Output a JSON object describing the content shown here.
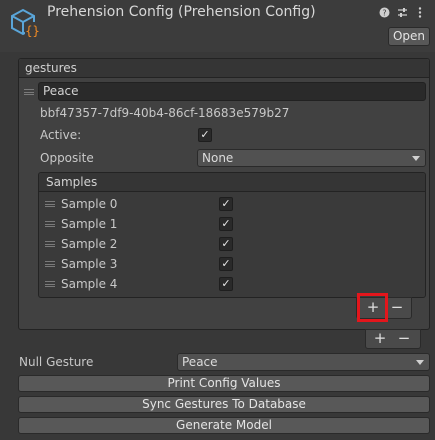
{
  "header": {
    "title": "Prehension Config (Prehension Config)",
    "open_label": "Open",
    "icons": [
      "help-icon",
      "settings-sliders-icon",
      "more-menu-icon"
    ]
  },
  "gestures": {
    "label": "gestures",
    "items": [
      {
        "name": "Peace",
        "guid": "bbf47357-7df9-40b4-86cf-18683e579b27",
        "active_label": "Active:",
        "active": true,
        "opposite_label": "Opposite",
        "opposite_value": "None",
        "samples": {
          "label": "Samples",
          "items": [
            {
              "label": "Sample 0",
              "checked": true
            },
            {
              "label": "Sample 1",
              "checked": true
            },
            {
              "label": "Sample 2",
              "checked": true
            },
            {
              "label": "Sample 3",
              "checked": true
            },
            {
              "label": "Sample 4",
              "checked": true
            }
          ]
        }
      }
    ]
  },
  "controls": {
    "plus": "+",
    "minus": "−"
  },
  "null_gesture": {
    "label": "Null Gesture",
    "value": "Peace"
  },
  "buttons": {
    "print": "Print Config Values",
    "sync": "Sync Gestures To Database",
    "generate": "Generate Model"
  },
  "colors": {
    "highlight": "#e3161c",
    "icon_blue": "#5aa5d8",
    "icon_orange": "#f08a24"
  }
}
